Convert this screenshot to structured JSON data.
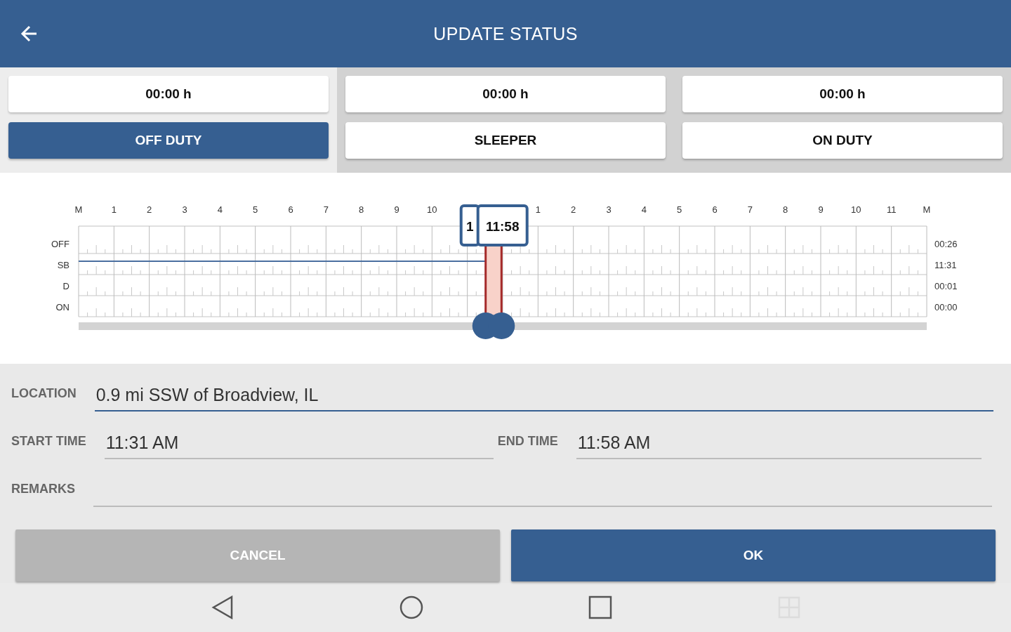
{
  "header": {
    "title": "UPDATE STATUS"
  },
  "statuses": [
    {
      "hours": "00:00 h",
      "label": "OFF DUTY",
      "selected": true
    },
    {
      "hours": "00:00 h",
      "label": "SLEEPER",
      "selected": false
    },
    {
      "hours": "00:00 h",
      "label": "ON DUTY",
      "selected": false
    }
  ],
  "graph": {
    "hour_labels_am": [
      "M",
      "1",
      "2",
      "3",
      "4",
      "5",
      "6",
      "7",
      "8",
      "9",
      "10"
    ],
    "hour_labels_pm": [
      "1",
      "2",
      "3",
      "4",
      "5",
      "6",
      "7",
      "8",
      "9",
      "10",
      "11",
      "M"
    ],
    "rows": [
      {
        "label": "OFF",
        "total": "00:26"
      },
      {
        "label": "SB",
        "total": "11:31",
        "line": {
          "level": 0.4799
        }
      },
      {
        "label": "D",
        "total": "00:01"
      },
      {
        "label": "ON",
        "total": "00:00"
      }
    ],
    "tooltips": [
      "1",
      "11:58"
    ],
    "handles": [
      {
        "level": 0.4799
      },
      {
        "level": 0.4986
      }
    ]
  },
  "form": {
    "location": {
      "label": "LOCATION",
      "value": "0.9 mi SSW of Broadview, IL",
      "focused": true
    },
    "start_time": {
      "label": "START TIME",
      "value": "11:31 AM"
    },
    "end_time": {
      "label": "END TIME",
      "value": "11:58 AM"
    },
    "remarks": {
      "label": "REMARKS"
    }
  },
  "buttons": [
    {
      "label": "CANCEL",
      "kind": "secondary"
    },
    {
      "label": "OK",
      "kind": "primary"
    }
  ]
}
